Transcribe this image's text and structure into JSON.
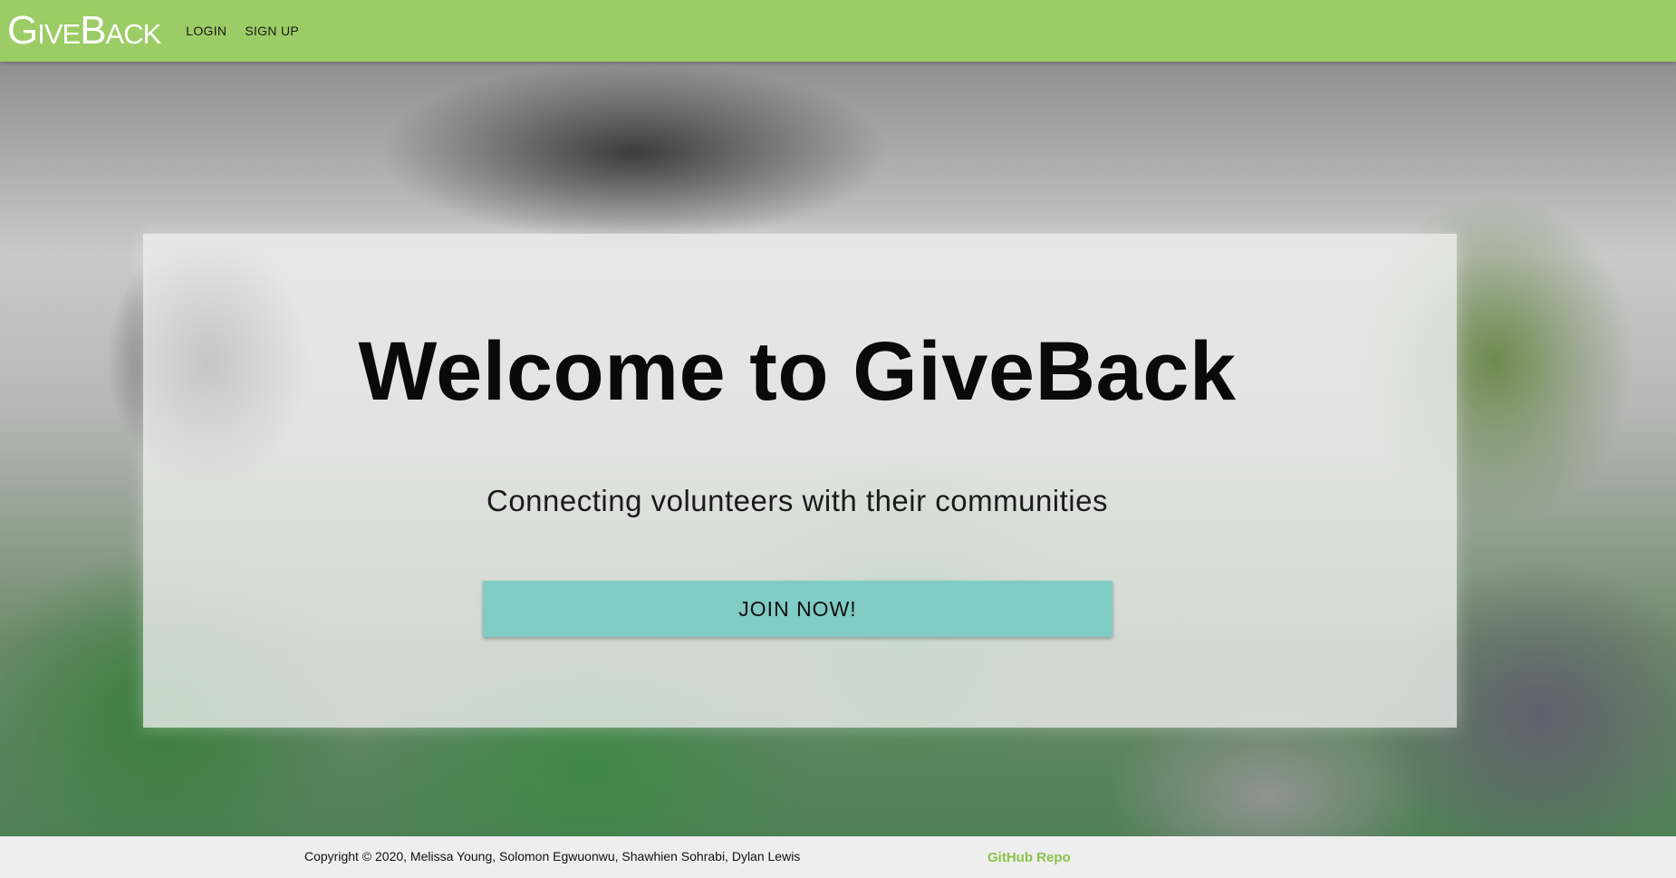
{
  "navbar": {
    "brand": "GiveBack",
    "links": [
      "Login",
      "Sign Up"
    ],
    "color": "#9ccc65"
  },
  "hero": {
    "title": "Welcome to GiveBack",
    "subtitle": "Connecting volunteers with their communities",
    "cta_label": "Join Now!",
    "cta_color": "#80cbc4"
  },
  "footer": {
    "copyright": "Copyright © 2020, Melissa Young, Solomon Egwuonwu, Shawhien Sohrabi, Dylan Lewis",
    "github_label": "GitHub Repo",
    "link_color": "#8bc34a"
  }
}
